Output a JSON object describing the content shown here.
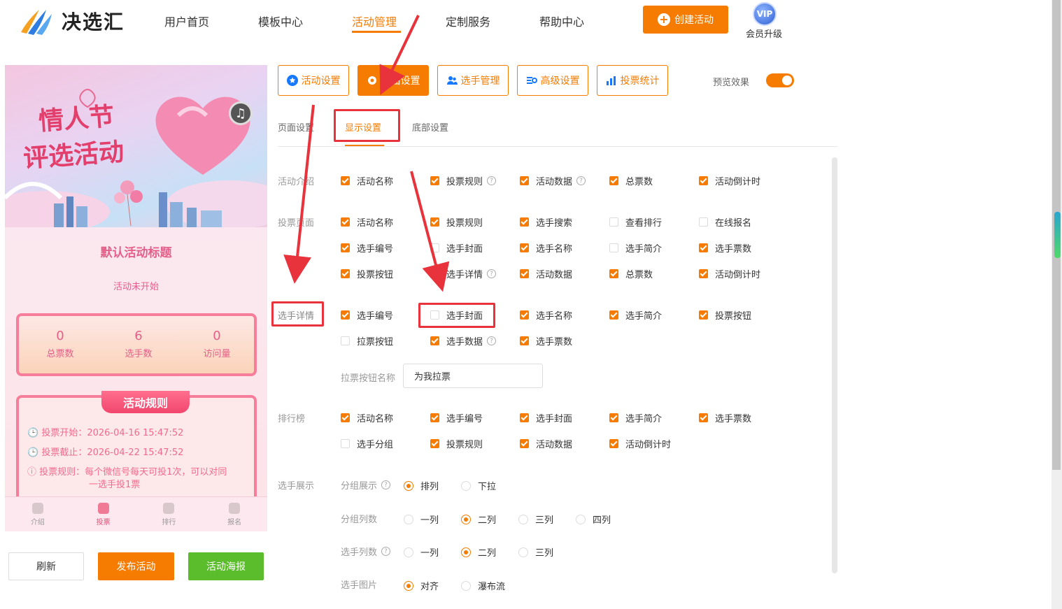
{
  "header": {
    "logo_text": "决选汇",
    "nav": [
      {
        "label": "用户首页"
      },
      {
        "label": "模板中心"
      },
      {
        "label": "活动管理"
      },
      {
        "label": "定制服务"
      },
      {
        "label": "帮助中心"
      }
    ],
    "create_label": "创建活动",
    "vip_badge": "VIP",
    "vip_label": "会员升级"
  },
  "preview": {
    "banner_title_1": "情人节",
    "banner_title_2": "评选活动",
    "title": "默认活动标题",
    "status": "活动未开始",
    "stats": [
      {
        "value": "0",
        "label": "总票数"
      },
      {
        "value": "6",
        "label": "选手数"
      },
      {
        "value": "0",
        "label": "访问量"
      }
    ],
    "rules_title": "活动规则",
    "rules": {
      "start": "投票开始：2026-04-16 15:47:52",
      "end": "投票截止：2026-04-22 15:47:52",
      "rule_1": "投票规则：每个微信号每天可投1次，可以对同",
      "rule_2": "一选手投1票"
    },
    "tabs": [
      {
        "label": "介绍"
      },
      {
        "label": "投票"
      },
      {
        "label": "排行"
      },
      {
        "label": "报名"
      }
    ]
  },
  "actions": {
    "refresh": "刷新",
    "publish": "发布活动",
    "poster": "活动海报"
  },
  "tools": [
    {
      "label": "活动设置"
    },
    {
      "label": "页面设置"
    },
    {
      "label": "选手管理"
    },
    {
      "label": "高级设置"
    },
    {
      "label": "投票统计"
    }
  ],
  "preview_toggle_label": "预览效果",
  "subtabs": [
    {
      "label": "页面设置"
    },
    {
      "label": "显示设置"
    },
    {
      "label": "底部设置"
    }
  ],
  "sections": {
    "intro": {
      "label": "活动介绍",
      "items": [
        "活动名称",
        "投票规则",
        "活动数据",
        "总票数",
        "活动倒计时"
      ]
    },
    "vote": {
      "label": "投票页面",
      "row1": [
        "活动名称",
        "投票规则",
        "选手搜索",
        "查看排行",
        "在线报名"
      ],
      "row2": [
        "选手编号",
        "选手封面",
        "选手名称",
        "选手简介",
        "选手票数"
      ],
      "row3": [
        "投票按钮",
        "选手详情",
        "活动数据",
        "总票数",
        "活动倒计时"
      ]
    },
    "detail": {
      "label": "选手详情",
      "row1": [
        "选手编号",
        "选手封面",
        "选手名称",
        "选手简介",
        "投票按钮"
      ],
      "row2": [
        "拉票按钮",
        "选手数据",
        "选手票数"
      ],
      "canvass_label": "拉票按钮名称",
      "canvass_value": "为我拉票"
    },
    "rank": {
      "label": "排行榜",
      "row1": [
        "活动名称",
        "选手编号",
        "选手封面",
        "选手简介",
        "选手票数"
      ],
      "row2": [
        "选手分组",
        "投票规则",
        "活动数据",
        "活动倒计时"
      ]
    },
    "display": {
      "label": "选手展示",
      "group_display": {
        "label": "分组展示",
        "options": [
          "排列",
          "下拉"
        ]
      },
      "group_columns": {
        "label": "分组列数",
        "options": [
          "一列",
          "二列",
          "三列",
          "四列"
        ]
      },
      "player_columns": {
        "label": "选手列数",
        "options": [
          "一列",
          "二列",
          "三列"
        ]
      },
      "player_image": {
        "label": "选手图片",
        "options": [
          "对齐",
          "瀑布流"
        ]
      }
    }
  },
  "colors": {
    "accent": "#f57c00",
    "annotation_red": "#e8323c",
    "poster_green": "#5bbd2b",
    "pink": "#e45f89"
  }
}
